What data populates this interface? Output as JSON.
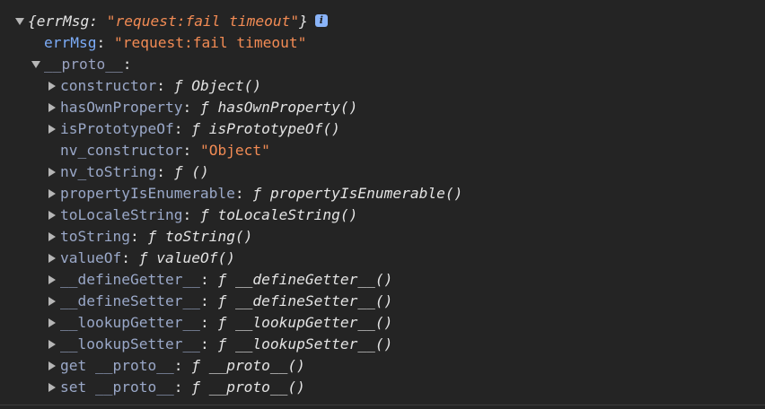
{
  "object": {
    "summary_open": "{",
    "summary_key": "errMsg",
    "summary_colon": ": ",
    "summary_value": "\"request:fail timeout\"",
    "summary_close": "}",
    "info_badge": "i"
  },
  "props": {
    "errMsg_key": "errMsg",
    "errMsg_value": "\"request:fail timeout\"",
    "proto_key": "__proto__",
    "proto_colon": ":"
  },
  "proto_items": [
    {
      "key": "constructor",
      "f": "ƒ",
      "value": "Object()"
    },
    {
      "key": "hasOwnProperty",
      "f": "ƒ",
      "value": "hasOwnProperty()"
    },
    {
      "key": "isPrototypeOf",
      "f": "ƒ",
      "value": "isPrototypeOf()"
    },
    {
      "key": "nv_constructor",
      "value": "\"Object\""
    },
    {
      "key": "nv_toString",
      "f": "ƒ",
      "value": "()"
    },
    {
      "key": "propertyIsEnumerable",
      "f": "ƒ",
      "value": "propertyIsEnumerable()"
    },
    {
      "key": "toLocaleString",
      "f": "ƒ",
      "value": "toLocaleString()"
    },
    {
      "key": "toString",
      "f": "ƒ",
      "value": "toString()"
    },
    {
      "key": "valueOf",
      "f": "ƒ",
      "value": "valueOf()"
    },
    {
      "key": "__defineGetter__",
      "f": "ƒ",
      "value": "__defineGetter__()"
    },
    {
      "key": "__defineSetter__",
      "f": "ƒ",
      "value": "__defineSetter__()"
    },
    {
      "key": "__lookupGetter__",
      "f": "ƒ",
      "value": "__lookupGetter__()"
    },
    {
      "key": "__lookupSetter__",
      "f": "ƒ",
      "value": "__lookupSetter__()"
    },
    {
      "key": "get __proto__",
      "f": "ƒ",
      "value": "__proto__()"
    },
    {
      "key": "set __proto__",
      "f": "ƒ",
      "value": "__proto__()"
    }
  ],
  "colors": {
    "background": "#242424",
    "key": "#7cacf8",
    "string": "#f28b54",
    "text": "#e3e3e3"
  }
}
